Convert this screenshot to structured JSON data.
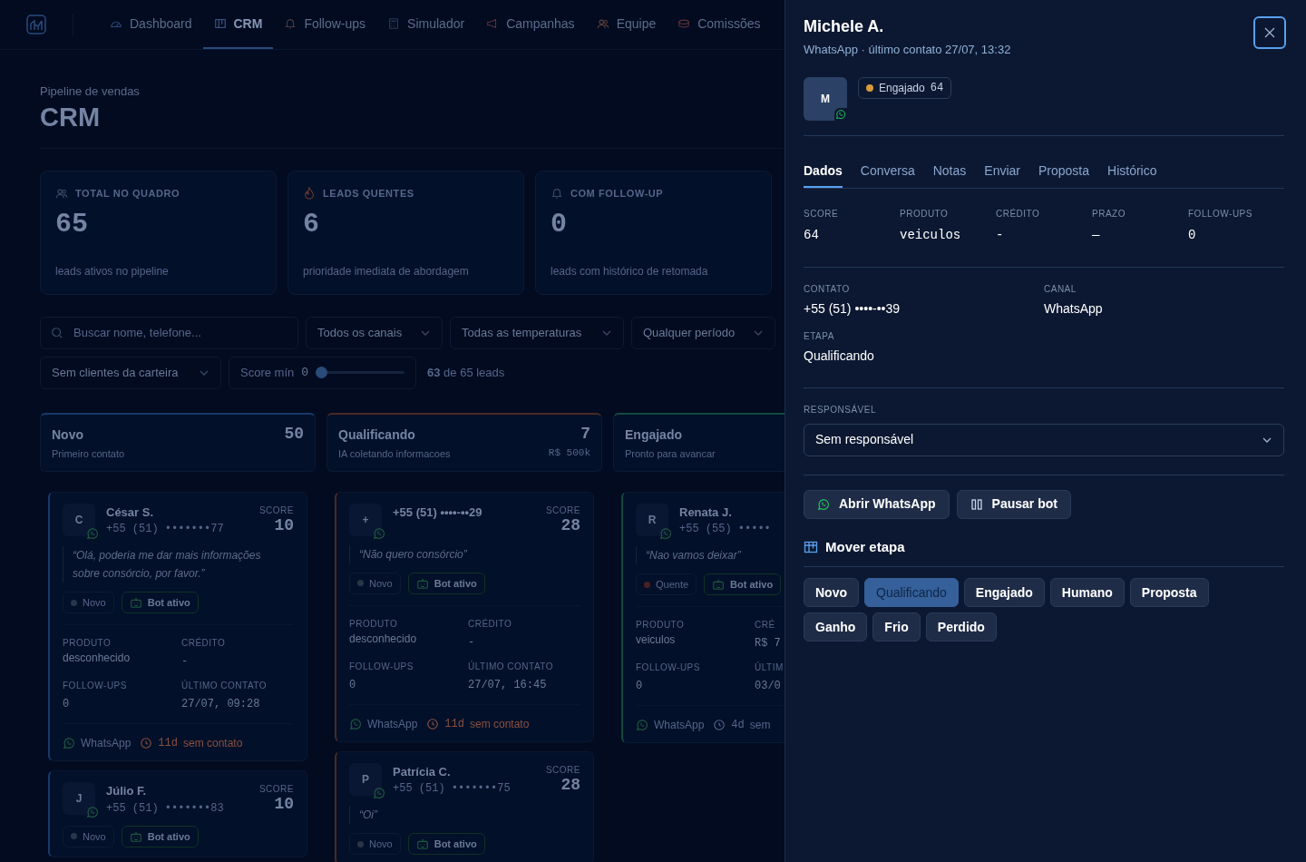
{
  "nav": {
    "items": [
      {
        "label": "Dashboard",
        "selected": false
      },
      {
        "label": "CRM",
        "selected": true
      },
      {
        "label": "Follow-ups",
        "selected": false
      },
      {
        "label": "Simulador",
        "selected": false
      },
      {
        "label": "Campanhas",
        "selected": false
      },
      {
        "label": "Equipe",
        "selected": false
      },
      {
        "label": "Comissões",
        "selected": false
      }
    ]
  },
  "header": {
    "subtitle": "Pipeline de vendas",
    "title": "CRM"
  },
  "stats": [
    {
      "label": "TOTAL NO QUADRO",
      "value": "65",
      "caption": "leads ativos no pipeline"
    },
    {
      "label": "LEADS QUENTES",
      "value": "6",
      "caption": "prioridade imediata de abordagem"
    },
    {
      "label": "COM FOLLOW-UP",
      "value": "0",
      "caption": "leads com histórico de retomada"
    }
  ],
  "filters": {
    "search": {
      "placeholder": "Buscar nome, telefone..."
    },
    "selects": [
      "Todos os canais",
      "Todas as temperaturas",
      "Qualquer período",
      "Sem clientes da carteira"
    ],
    "score": {
      "label": "Score mín",
      "value": "0",
      "level": 0
    },
    "count": "**63** de 65 leads"
  },
  "columns": [
    {
      "title": "Novo",
      "subtitle": "Primeiro contato",
      "count": "50",
      "color": "#173a6b",
      "cards": [
        {
          "avatar": "C",
          "name": "César S.",
          "phone": "+55 (51) •••••••77",
          "score_label": "SCORE",
          "score": "10",
          "quote": "“Olá, poderia me dar mais informações sobre consórcio, por favor.”",
          "tags": [
            {
              "kind": "status",
              "label": "Novo",
              "color": "#2b3548"
            },
            {
              "kind": "bot",
              "label": "Bot ativo"
            }
          ],
          "fields": [
            {
              "label": "PRODUTO",
              "value": "desconhecido"
            },
            {
              "label": "CRÉDITO",
              "value": "-"
            },
            {
              "label": "FOLLOW-UPS",
              "value": "0"
            },
            {
              "label": "ÚLTIMO CONTATO",
              "value": "27/07, 09:28"
            }
          ],
          "footer": {
            "channel": "WhatsApp",
            "age": "11d",
            "note": "sem contato",
            "overdue": true
          }
        },
        {
          "avatar": "J",
          "name": "Júlio F.",
          "phone": "+55 (51) •••••••83",
          "score_label": "SCORE",
          "score": "10",
          "tags": [
            {
              "kind": "status",
              "label": "Novo",
              "color": "#2b3548"
            },
            {
              "kind": "bot",
              "label": "Bot ativo"
            }
          ]
        }
      ]
    },
    {
      "title": "Qualificando",
      "subtitle": "IA coletando informacoes",
      "count": "7",
      "total": "R$ 500k",
      "color": "#4a2a22",
      "cards": [
        {
          "avatar": "+",
          "name": "+55 (51) ••••-••29",
          "score_label": "SCORE",
          "score": "28",
          "quote": "“Não quero consórcio”",
          "tags": [
            {
              "kind": "status",
              "label": "Novo",
              "color": "#2b3548"
            },
            {
              "kind": "bot",
              "label": "Bot ativo"
            }
          ],
          "fields": [
            {
              "label": "PRODUTO",
              "value": "desconhecido"
            },
            {
              "label": "CRÉDITO",
              "value": "-"
            },
            {
              "label": "FOLLOW-UPS",
              "value": "0"
            },
            {
              "label": "ÚLTIMO CONTATO",
              "value": "27/07, 16:45"
            }
          ],
          "footer": {
            "channel": "WhatsApp",
            "age": "11d",
            "note": "sem contato",
            "overdue": true
          }
        },
        {
          "avatar": "P",
          "name": "Patrícia C.",
          "phone": "+55 (51) •••••••75",
          "score_label": "SCORE",
          "score": "28",
          "quote": "“Oi”",
          "tags": [
            {
              "kind": "status",
              "label": "Novo",
              "color": "#2b3548"
            },
            {
              "kind": "bot",
              "label": "Bot ativo"
            }
          ]
        }
      ]
    },
    {
      "title": "Engajado",
      "subtitle": "Pronto para avancar",
      "color": "#0f4a3d",
      "cards": [
        {
          "avatar": "R",
          "name": "Renata J.",
          "phone": "+55 (55) •••••",
          "quote": "“Nao vamos deixar”",
          "tags": [
            {
              "kind": "status",
              "label": "Quente",
              "color": "#4a2020"
            },
            {
              "kind": "bot",
              "label": "Bot ativo"
            }
          ],
          "fields": [
            {
              "label": "PRODUTO",
              "value": "veiculos"
            },
            {
              "label": "CRÉ",
              "value": "R$ 7"
            },
            {
              "label": "FOLLOW-UPS",
              "value": "0"
            },
            {
              "label": "ÚLTIM",
              "value": "03/0"
            }
          ],
          "footer": {
            "channel": "WhatsApp",
            "age": "4d",
            "note": "sem",
            "overdue": false
          }
        }
      ]
    }
  ],
  "drawer": {
    "name": "Michele A.",
    "subtitle": "WhatsApp · último contato 27/07, 13:32",
    "avatar": "M",
    "badge": {
      "label": "Engajado",
      "score": "64",
      "color": "#d99a3a"
    },
    "tabs": [
      {
        "label": "Dados",
        "selected": true
      },
      {
        "label": "Conversa",
        "selected": false
      },
      {
        "label": "Notas",
        "selected": false
      },
      {
        "label": "Enviar",
        "selected": false
      },
      {
        "label": "Proposta",
        "selected": false
      },
      {
        "label": "Histórico",
        "selected": false
      }
    ],
    "metrics": [
      {
        "label": "SCORE",
        "value": "64"
      },
      {
        "label": "PRODUTO",
        "value": "veiculos"
      },
      {
        "label": "CRÉDITO",
        "value": "-"
      },
      {
        "label": "PRAZO",
        "value": "—"
      },
      {
        "label": "FOLLOW-UPS",
        "value": "0"
      }
    ],
    "details": [
      {
        "label": "CONTATO",
        "value": "+55 (51) ••••-••39"
      },
      {
        "label": "CANAL",
        "value": "WhatsApp"
      },
      {
        "label": "ETAPA",
        "value": "Qualificando"
      }
    ],
    "owner": {
      "label": "RESPONSÁVEL",
      "value": "Sem responsável"
    },
    "actions": [
      "Abrir WhatsApp",
      "Pausar bot"
    ],
    "move": {
      "title": "Mover etapa",
      "stages": [
        {
          "label": "Novo",
          "selected": false
        },
        {
          "label": "Qualificando",
          "selected": true
        },
        {
          "label": "Engajado",
          "selected": false
        },
        {
          "label": "Humano",
          "selected": false
        },
        {
          "label": "Proposta",
          "selected": false
        },
        {
          "label": "Ganho",
          "selected": false
        },
        {
          "label": "Frio",
          "selected": false
        },
        {
          "label": "Perdido",
          "selected": false
        }
      ]
    }
  }
}
